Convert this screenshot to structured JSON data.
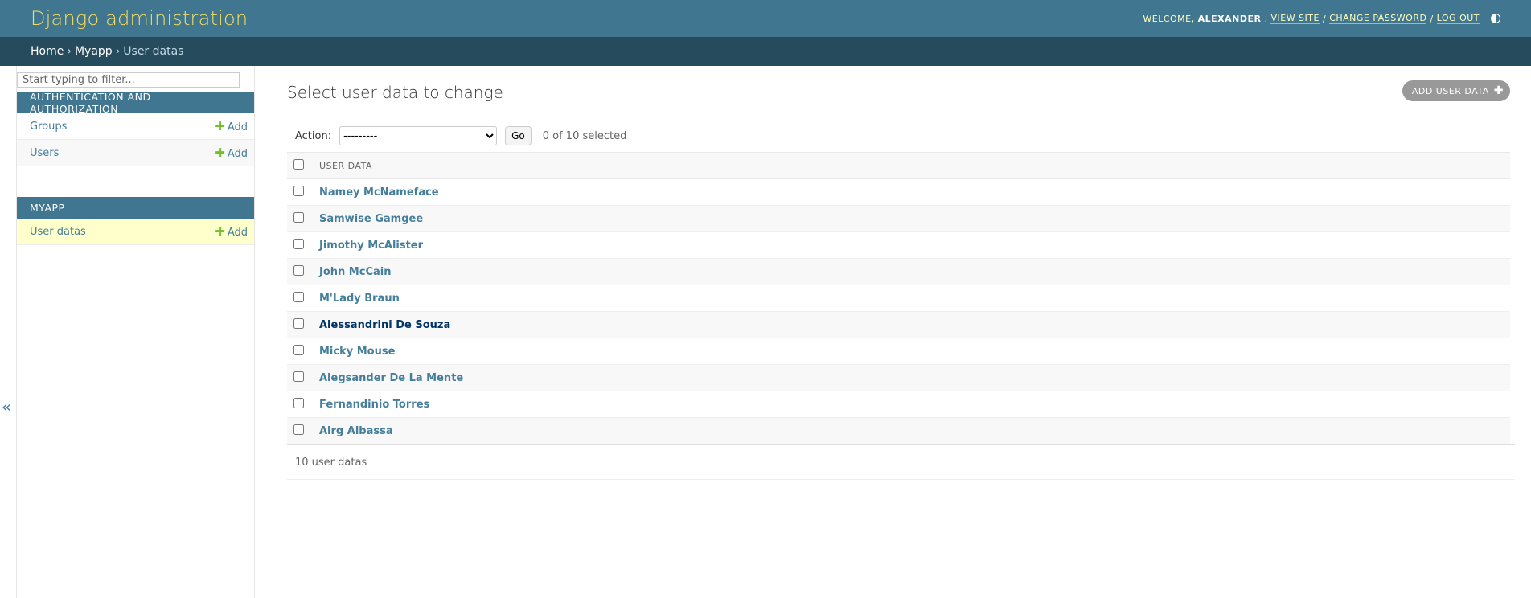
{
  "header": {
    "brand": "Django administration",
    "welcome": "WELCOME,",
    "username": "ALEXANDER",
    "view_site": "VIEW SITE",
    "change_password": "CHANGE PASSWORD",
    "log_out": "LOG OUT",
    "sep": "/"
  },
  "breadcrumbs": {
    "home": "Home",
    "app": "Myapp",
    "current": "User datas",
    "sep": "›"
  },
  "sidebar": {
    "filter_placeholder": "Start typing to filter...",
    "apps": [
      {
        "caption": "AUTHENTICATION AND AUTHORIZATION",
        "models": [
          {
            "name": "Groups",
            "add": "Add"
          },
          {
            "name": "Users",
            "add": "Add"
          }
        ]
      },
      {
        "caption": "MYAPP",
        "models": [
          {
            "name": "User datas",
            "add": "Add"
          }
        ]
      }
    ],
    "collapse_glyph": "«"
  },
  "content": {
    "title": "Select user data to change",
    "add_button": "ADD USER DATA",
    "action_label": "Action:",
    "action_selected": "---------",
    "go_label": "Go",
    "selected_counter": "0 of 10 selected",
    "column_header": "USER DATA",
    "rows": [
      "Namey McNameface",
      "Samwise Gamgee",
      "Jimothy McAlister",
      "John McCain",
      "M'Lady Braun",
      "Alessandrini De Souza",
      "Micky Mouse",
      "Alegsander De La Mente",
      "Fernandinio Torres",
      "Alrg Albassa"
    ],
    "paginator": "10 user datas"
  },
  "colors": {
    "header_bg": "#417690",
    "breadcrumb_bg": "#264b5d",
    "brand": "#f5dd5d",
    "link": "#447e9b",
    "add_plus": "#70bf2b",
    "current_row": "#ffffcc"
  }
}
